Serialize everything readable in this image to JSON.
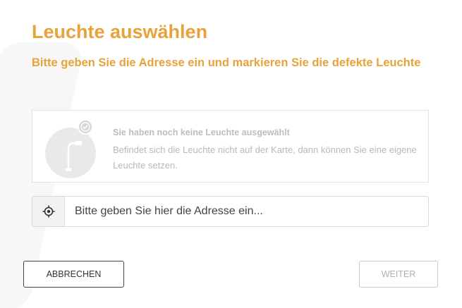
{
  "dialog": {
    "title": "Leuchte auswählen",
    "subtitle": "Bitte geben Sie die Adresse ein und markieren Sie die defekte Leuchte"
  },
  "info": {
    "title": "Sie haben noch keine Leuchte ausgewählt",
    "text": "Befindet sich die Leuchte nicht auf der Karte, dann können Sie eine eigene Leuchte setzen.",
    "icon": "street-lamp-icon"
  },
  "search": {
    "placeholder": "Bitte geben Sie hier die Adresse ein...",
    "value": "",
    "icon": "location-target-icon"
  },
  "buttons": {
    "cancel_label": "ABBRECHEN",
    "next_label": "WEITER"
  },
  "colors": {
    "accent": "#e8a23a",
    "muted_text": "#b8b8b8"
  }
}
